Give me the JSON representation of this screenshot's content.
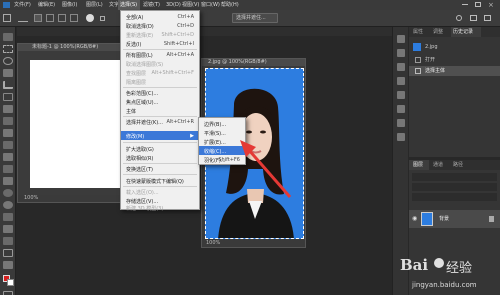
{
  "menubar": {
    "items": [
      "文件(F)",
      "编辑(E)",
      "图像(I)",
      "图层(L)",
      "文字(Y)",
      "选择(S)",
      "滤镜(T)",
      "3D(D)",
      "视图(V)",
      "窗口(W)",
      "帮助(H)"
    ],
    "active_index": 5
  },
  "options": {
    "select_subject": "选择并遮住..."
  },
  "documents": {
    "back_tab": "未标题-1 @ 100%(RGB/8#)",
    "back_zoom": "100%",
    "front_title": "2.jpg @ 100%(RGB/8#)",
    "front_zoom": "100%"
  },
  "select_menu": {
    "items": [
      {
        "label": "全部(A)",
        "shortcut": "Ctrl+A",
        "disabled": false
      },
      {
        "label": "取消选择(D)",
        "shortcut": "Ctrl+D",
        "disabled": false
      },
      {
        "label": "重新选择(E)",
        "shortcut": "Shift+Ctrl+D",
        "disabled": true
      },
      {
        "label": "反选(I)",
        "shortcut": "Shift+Ctrl+I",
        "disabled": false
      },
      {
        "label": "所有图层(L)",
        "shortcut": "Alt+Ctrl+A",
        "disabled": false
      },
      {
        "label": "取消选择图层(S)",
        "shortcut": "",
        "disabled": true
      },
      {
        "label": "查找图层",
        "shortcut": "Alt+Shift+Ctrl+F",
        "disabled": true
      },
      {
        "label": "隔离图层",
        "shortcut": "",
        "disabled": true
      },
      {
        "label": "色彩范围(C)...",
        "shortcut": "",
        "disabled": false
      },
      {
        "label": "焦点区域(U)...",
        "shortcut": "",
        "disabled": false
      },
      {
        "label": "主体",
        "shortcut": "",
        "disabled": false
      },
      {
        "label": "选择并遮住(K)...",
        "shortcut": "Alt+Ctrl+R",
        "disabled": false
      },
      {
        "label": "修改(M)",
        "shortcut": "",
        "disabled": false
      },
      {
        "label": "扩大选取(G)",
        "shortcut": "",
        "disabled": false
      },
      {
        "label": "选取相似(R)",
        "shortcut": "",
        "disabled": false
      },
      {
        "label": "变换选区(T)",
        "shortcut": "",
        "disabled": false
      },
      {
        "label": "在快速蒙版模式下编辑(Q)",
        "shortcut": "",
        "disabled": false
      },
      {
        "label": "载入选区(O)...",
        "shortcut": "",
        "disabled": true
      },
      {
        "label": "存储选区(V)...",
        "shortcut": "",
        "disabled": false
      },
      {
        "label": "新建 3D 模型(3)",
        "shortcut": "",
        "disabled": true
      }
    ]
  },
  "modify_submenu": {
    "items": [
      {
        "label": "边界(B)...",
        "shortcut": ""
      },
      {
        "label": "平滑(S)...",
        "shortcut": ""
      },
      {
        "label": "扩展(E)...",
        "shortcut": ""
      },
      {
        "label": "收缩(C)...",
        "shortcut": ""
      },
      {
        "label": "羽化(F)...",
        "shortcut": "Shift+F6"
      }
    ],
    "highlighted_index": 3
  },
  "history_panel": {
    "tabs": [
      "属性",
      "调整",
      "历史记录"
    ],
    "file": "2.jpg",
    "entries": [
      "打开",
      "选择主体"
    ]
  },
  "layers_panel": {
    "tabs": [
      "图层",
      "通道",
      "路径"
    ],
    "layer_name": "背景"
  },
  "watermark": {
    "brand": "Bai",
    "brand2": "经验",
    "url": "jingyan.baidu.com"
  },
  "colors": {
    "menu_highlight": "#3b78d8",
    "photo_bg": "#2d7de0",
    "arrow": "#e53935"
  }
}
